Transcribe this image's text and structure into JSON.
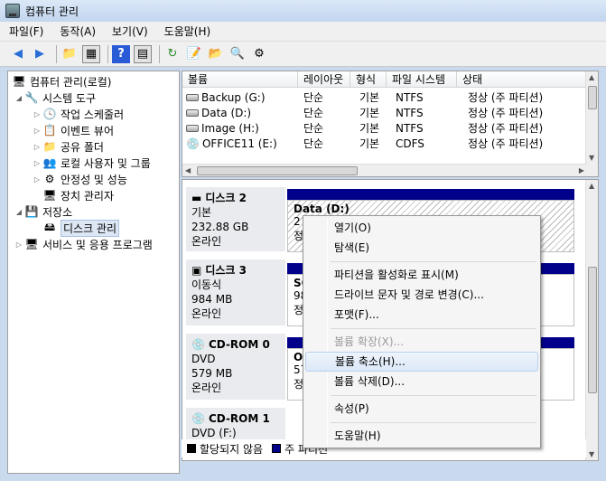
{
  "window": {
    "title": "컴퓨터 관리"
  },
  "menubar": [
    {
      "label": "파일(F)"
    },
    {
      "label": "동작(A)"
    },
    {
      "label": "보기(V)"
    },
    {
      "label": "도움말(H)"
    }
  ],
  "toolbar": {
    "icons": [
      "back-icon",
      "forward-icon",
      "up-folder-icon",
      "show-hide-tree-icon",
      "help-icon",
      "show-hide-action-pane-icon",
      "refresh-icon",
      "properties-icon",
      "open-folder-icon",
      "search-icon",
      "settings-icon"
    ]
  },
  "tree": {
    "items": [
      {
        "label": "컴퓨터 관리(로컬)"
      },
      {
        "label": "시스템 도구"
      },
      {
        "label": "작업 스케줄러"
      },
      {
        "label": "이벤트 뷰어"
      },
      {
        "label": "공유 폴더"
      },
      {
        "label": "로컬 사용자 및 그룹"
      },
      {
        "label": "안정성 및 성능"
      },
      {
        "label": "장치 관리자"
      },
      {
        "label": "저장소"
      },
      {
        "label": "디스크 관리"
      },
      {
        "label": "서비스 및 응용 프로그램"
      }
    ]
  },
  "volumes": {
    "columns": [
      "볼륨",
      "레이아웃",
      "형식",
      "파일 시스템",
      "상태"
    ],
    "rows": [
      {
        "name": "Backup (G:)",
        "layout": "단순",
        "type": "기본",
        "fs": "NTFS",
        "status": "정상 (주 파티션)"
      },
      {
        "name": "Data (D:)",
        "layout": "단순",
        "type": "기본",
        "fs": "NTFS",
        "status": "정상 (주 파티션)"
      },
      {
        "name": "Image (H:)",
        "layout": "단순",
        "type": "기본",
        "fs": "NTFS",
        "status": "정상 (주 파티션)"
      },
      {
        "name": "OFFICE11 (E:)",
        "layout": "단순",
        "type": "기본",
        "fs": "CDFS",
        "status": "정상 (주 파티션)"
      }
    ]
  },
  "disks": [
    {
      "name": "디스크 2",
      "kind": "기본",
      "size": "232.88 GB",
      "state": "온라인",
      "part_title": "Data  (D:)",
      "part_line2": "2",
      "part_line3": "정"
    },
    {
      "name": "디스크 3",
      "kind": "이동식",
      "size": "984 MB",
      "state": "온라인",
      "part_title": "SC",
      "part_line2": "98",
      "part_line3": "정"
    },
    {
      "name": "CD-ROM 0",
      "kind": "DVD",
      "size": "579 MB",
      "state": "온라인",
      "part_title": "O",
      "part_line2": "57",
      "part_line3": "정"
    },
    {
      "name": "CD-ROM 1",
      "kind": "DVD (F:)",
      "size": "",
      "state": "",
      "part_title": "",
      "part_line2": "",
      "part_line3": ""
    }
  ],
  "legend": [
    {
      "label": "할당되지 않음",
      "color": "#000000"
    },
    {
      "label": "주 파티션",
      "color": "#00008b"
    }
  ],
  "context_menu": {
    "items": [
      {
        "label": "열기(O)",
        "disabled": false
      },
      {
        "label": "탐색(E)",
        "disabled": false
      },
      {
        "label": "파티션을 활성화로 표시(M)",
        "disabled": false
      },
      {
        "label": "드라이브 문자 및 경로 변경(C)...",
        "disabled": false
      },
      {
        "label": "포맷(F)...",
        "disabled": false
      },
      {
        "label": "볼륨 확장(X)...",
        "disabled": true
      },
      {
        "label": "볼륨 축소(H)...",
        "disabled": false,
        "highlighted": true
      },
      {
        "label": "볼륨 삭제(D)...",
        "disabled": false
      },
      {
        "label": "속성(P)",
        "disabled": false
      },
      {
        "label": "도움말(H)",
        "disabled": false
      }
    ]
  }
}
